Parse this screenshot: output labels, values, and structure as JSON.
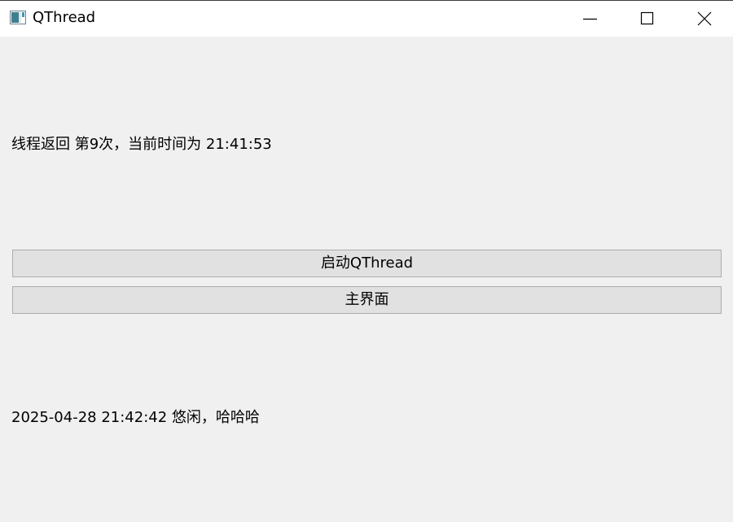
{
  "window": {
    "title": "QThread",
    "icon": "qt-window-icon",
    "controls": {
      "minimize_icon": "minimize-icon",
      "maximize_icon": "maximize-icon",
      "close_icon": "close-icon"
    }
  },
  "main": {
    "thread_label": "线程返回 第9次，当前时间为 21:41:53",
    "start_button_label": "启动QThread",
    "main_button_label": "主界面",
    "status_label": "2025-04-28 21:42:42 悠闲，哈哈哈"
  },
  "colors": {
    "background": "#f0f0f0",
    "titlebar": "#ffffff",
    "button_face": "#e1e1e1",
    "button_border": "#adadad"
  }
}
